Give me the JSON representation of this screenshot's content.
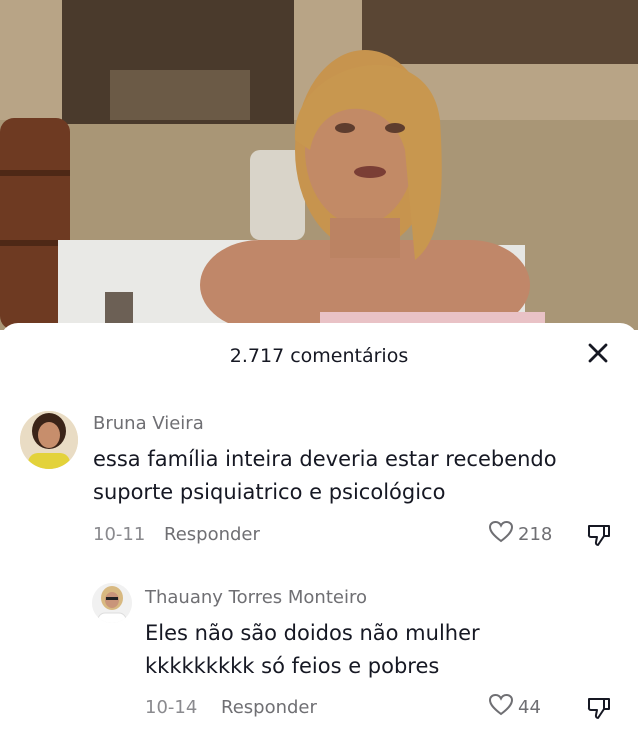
{
  "header": {
    "comment_count": "2.717 comentários"
  },
  "icons": {
    "close": "close-icon",
    "like": "heart-outline-icon",
    "dislike": "thumbs-down-icon"
  },
  "comments": [
    {
      "username": "Bruna Vieira",
      "text_line1": "essa família inteira deveria estar recebendo",
      "text_line2": "suporte psiquiatrico e psicológico",
      "date": "10-11",
      "reply_label": "Responder",
      "likes": "218"
    },
    {
      "username": "Thauany Torres Monteiro",
      "text_line1": "Eles não são doidos não mulher",
      "text_line2": "kkkkkkkkk só feios e pobres",
      "date": "10-14",
      "reply_label": "Responder",
      "likes": "44"
    }
  ]
}
